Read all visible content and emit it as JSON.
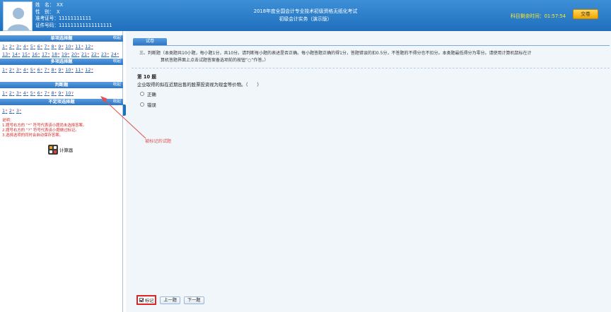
{
  "header": {
    "candidate": {
      "name_label": "姓　名：",
      "name_value": "XX",
      "gender_label": "性　别：",
      "gender_value": "X",
      "ticket_label": "准考证号：",
      "ticket_value": "11111111111",
      "id_label": "证件号码：",
      "id_value": "111111111111111111"
    },
    "exam_title": "2018年度全国会计专业技术初级资格无纸化考试",
    "exam_subtitle": "初级会计实务（演示版）",
    "timer_label": "科目剩余时间：",
    "timer_value": "01:57:54",
    "submit_label": "交卷"
  },
  "sidebar": {
    "sections": [
      {
        "title": "单项选择题",
        "collapse": "收起",
        "rows": [
          [
            {
              "n": "1",
              "s": "*"
            },
            {
              "n": "2",
              "s": "*"
            },
            {
              "n": "3",
              "s": "*"
            },
            {
              "n": "4",
              "s": "*"
            },
            {
              "n": "5",
              "s": "*"
            },
            {
              "n": "6",
              "s": "*"
            },
            {
              "n": "7",
              "s": "*"
            },
            {
              "n": "8",
              "s": "*"
            },
            {
              "n": "9",
              "s": "*"
            },
            {
              "n": "10",
              "s": "*"
            },
            {
              "n": "11",
              "s": "*"
            },
            {
              "n": "12",
              "s": "*"
            }
          ],
          [
            {
              "n": "13",
              "s": "*"
            },
            {
              "n": "14",
              "s": "*"
            },
            {
              "n": "15",
              "s": "*"
            },
            {
              "n": "16",
              "s": "*"
            },
            {
              "n": "17",
              "s": "*"
            },
            {
              "n": "18",
              "s": "*"
            },
            {
              "n": "19",
              "s": "*"
            },
            {
              "n": "20",
              "s": "*"
            },
            {
              "n": "21",
              "s": "*"
            },
            {
              "n": "22",
              "s": "*"
            },
            {
              "n": "23",
              "s": "*"
            },
            {
              "n": "24",
              "s": "*"
            }
          ]
        ]
      },
      {
        "title": "多项选择题",
        "collapse": "收起",
        "rows": [
          [
            {
              "n": "1",
              "s": "*"
            },
            {
              "n": "2",
              "s": "*"
            },
            {
              "n": "3",
              "s": "*"
            },
            {
              "n": "4",
              "s": "*"
            },
            {
              "n": "5",
              "s": "*"
            },
            {
              "n": "6",
              "s": "*"
            },
            {
              "n": "7",
              "s": "*"
            },
            {
              "n": "8",
              "s": "*"
            },
            {
              "n": "9",
              "s": "*"
            },
            {
              "n": "10",
              "s": "*"
            },
            {
              "n": "11",
              "s": "*"
            },
            {
              "n": "12",
              "s": "*"
            }
          ]
        ]
      },
      {
        "title": "判断题",
        "collapse": "收起",
        "rows": [
          [
            {
              "n": "1",
              "s": "*"
            },
            {
              "n": "2",
              "s": "*"
            },
            {
              "n": "3",
              "s": "*"
            },
            {
              "n": "4",
              "s": "*"
            },
            {
              "n": "5",
              "s": "*"
            },
            {
              "n": "6",
              "s": "*"
            },
            {
              "n": "7",
              "s": "*"
            },
            {
              "n": "8",
              "s": "*"
            },
            {
              "n": "9",
              "s": "*"
            },
            {
              "n": "10",
              "s": "?"
            }
          ]
        ]
      },
      {
        "title": "不定项选择题",
        "collapse": "收起",
        "rows": [
          [
            {
              "n": "1",
              "s": "*"
            },
            {
              "n": "2",
              "s": "*"
            },
            {
              "n": "3",
              "s": "*"
            }
          ]
        ]
      }
    ],
    "notes": [
      "说明：",
      "1.题号右方的 “*” 符号代表该小题尚未选择答案。",
      "2.题号右方的 “?” 符号代表该小题做过标记。",
      "3.选择选项的同时会自动保存答案。"
    ],
    "calculator_label": "计算器"
  },
  "main": {
    "paper_tab": "试卷",
    "instruction_line1": "三、判断题（本类题共10小题，每小题1分，共10分。请判断每小题的表述是否正确。每小题答题正确的得1分，答题错误的扣0.5分，不答题的不得分也不扣分。本类题最低得分为零分。请使用计算机鼠标在计",
    "instruction_line2": "算机答题界面上点击试题答案备选项前的按钮“○”作答。）",
    "question_number": "第 10 题",
    "question_text": "企业取得的拟在近期出售的股票投资视为现金等价物。（　　）",
    "options": [
      "正确",
      "错误"
    ],
    "callout": "被标记的试题",
    "mark_label": "标记",
    "prev_label": "上一题",
    "next_label": "下一题"
  },
  "colors": {
    "header_blue": "#1f6fbd",
    "timer_yellow": "#ffea2e",
    "annotation_red": "#e02424"
  }
}
